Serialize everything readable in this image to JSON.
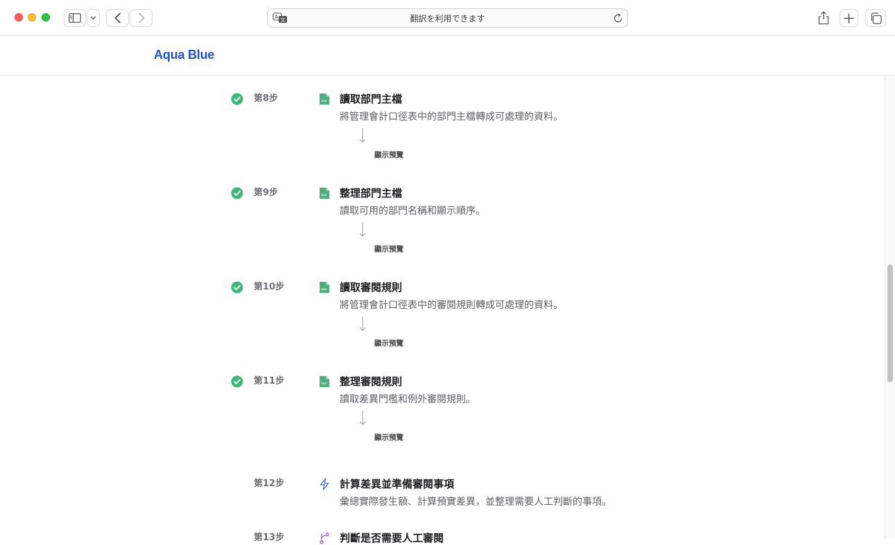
{
  "browser": {
    "address_text": "翻訳を利用できます"
  },
  "site": {
    "brand": "Aqua Blue",
    "brand_color": "#1f4fd1"
  },
  "steps": [
    {
      "number": "第8步",
      "title": "讀取部門主檔",
      "description": "將管理會計口徑表中的部門主檔轉成可處理的資料。",
      "preview": "顯示預覽",
      "status": "completed",
      "icon": "csv-file-icon"
    },
    {
      "number": "第9步",
      "title": "整理部門主檔",
      "description": "讀取可用的部門名稱和顯示順序。",
      "preview": "顯示預覽",
      "status": "completed",
      "icon": "csv-file-icon"
    },
    {
      "number": "第10步",
      "title": "讀取審閱規則",
      "description": "將管理會計口徑表中的審閱規則轉成可處理的資料。",
      "preview": "顯示預覽",
      "status": "completed",
      "icon": "csv-file-icon"
    },
    {
      "number": "第11步",
      "title": "整理審閱規則",
      "description": "讀取差異門檻和例外審閱規則。",
      "preview": "顯示預覽",
      "status": "completed",
      "icon": "csv-file-icon"
    },
    {
      "number": "第12步",
      "title": "計算差異並準備審閱事項",
      "description": "彙總實際發生額、計算預實差異，並整理需要人工判斷的事項。",
      "status": "pending",
      "icon": "lightning-icon"
    },
    {
      "number": "第13步",
      "title": "判斷是否需要人工審閱",
      "status": "pending",
      "icon": "branch-icon"
    }
  ],
  "colors": {
    "check_green": "#3cb878",
    "csv_green": "#4caf7d",
    "lightning_blue": "#3b6fe0",
    "branch_purple": "#9b5de5"
  }
}
